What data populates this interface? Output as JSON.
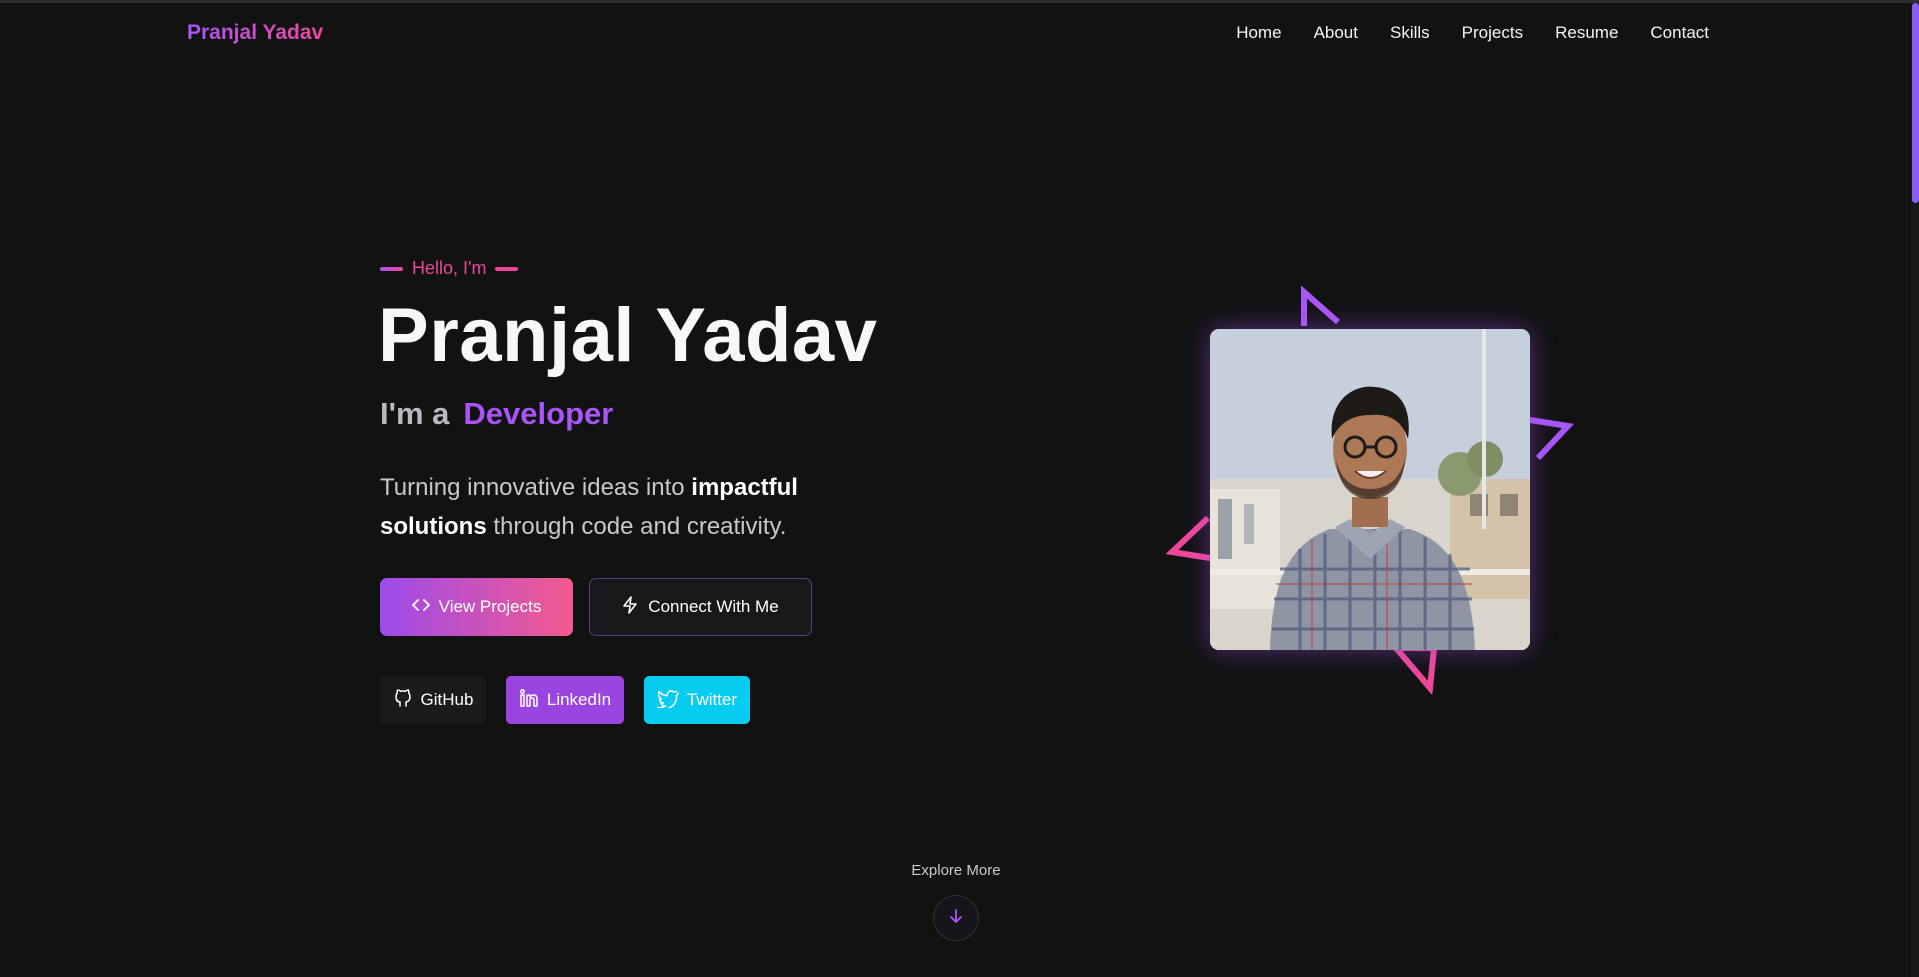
{
  "brand": {
    "name": "Pranjal Yadav"
  },
  "nav": {
    "items": [
      {
        "label": "Home"
      },
      {
        "label": "About"
      },
      {
        "label": "Skills"
      },
      {
        "label": "Projects"
      },
      {
        "label": "Resume"
      },
      {
        "label": "Contact"
      }
    ]
  },
  "hero": {
    "greeting": "Hello, I'm",
    "name": "Pranjal Yadav",
    "role_prefix": "I'm a",
    "role_highlight": "Developer",
    "description": {
      "part1": "Turning innovative ideas into ",
      "bold1": "impactful solutions",
      "part2": " through code and creativity."
    },
    "primary_button": "View Projects",
    "secondary_button": "Connect With Me",
    "social": {
      "github": "GitHub",
      "linkedin": "LinkedIn",
      "twitter": "Twitter"
    }
  },
  "explore": {
    "label": "Explore More"
  },
  "colors": {
    "background": "#121213",
    "accent_purple": "#a855f7",
    "accent_pink": "#ec4899",
    "linkedin": "#9b45e0",
    "twitter": "#06cdf0"
  },
  "icons": {
    "primary_button": "code-icon",
    "secondary_button": "lightning-icon",
    "github": "github-icon",
    "linkedin": "linkedin-icon",
    "twitter": "twitter-icon",
    "explore": "arrow-down-icon"
  }
}
